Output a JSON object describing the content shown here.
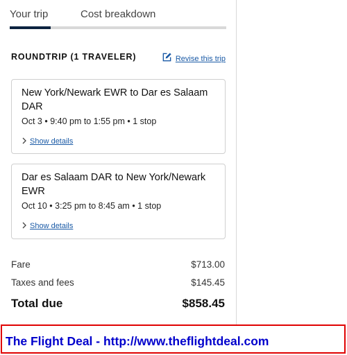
{
  "tabs": [
    {
      "label": "Your trip",
      "active": true
    },
    {
      "label": "Cost breakdown",
      "active": false
    }
  ],
  "trip": {
    "heading": "ROUNDTRIP (1 TRAVELER)",
    "revise_label": "Revise this trip"
  },
  "flights": [
    {
      "route": "New York/Newark EWR to Dar es Salaam DAR",
      "times": "Oct 3 • 9:40 pm to 1:55 pm • 1 stop",
      "details_label": "Show details"
    },
    {
      "route": "Dar es Salaam DAR to New York/Newark EWR",
      "times": "Oct 10 • 3:25 pm to 8:45 am • 1 stop",
      "details_label": "Show details"
    }
  ],
  "costs": {
    "fare_label": "Fare",
    "fare_value": "$713.00",
    "taxes_label": "Taxes and fees",
    "taxes_value": "$145.45",
    "total_label": "Total due",
    "total_value": "$858.45"
  },
  "banner": {
    "text": "The Flight Deal - http://www.theflightdeal.com"
  },
  "colors": {
    "accent": "#0c2340",
    "link": "#1a5aa6",
    "banner_border": "#e00000",
    "banner_text": "#0000cc"
  },
  "icons": {
    "revise": "edit-icon",
    "details": "chevron-right-icon"
  }
}
